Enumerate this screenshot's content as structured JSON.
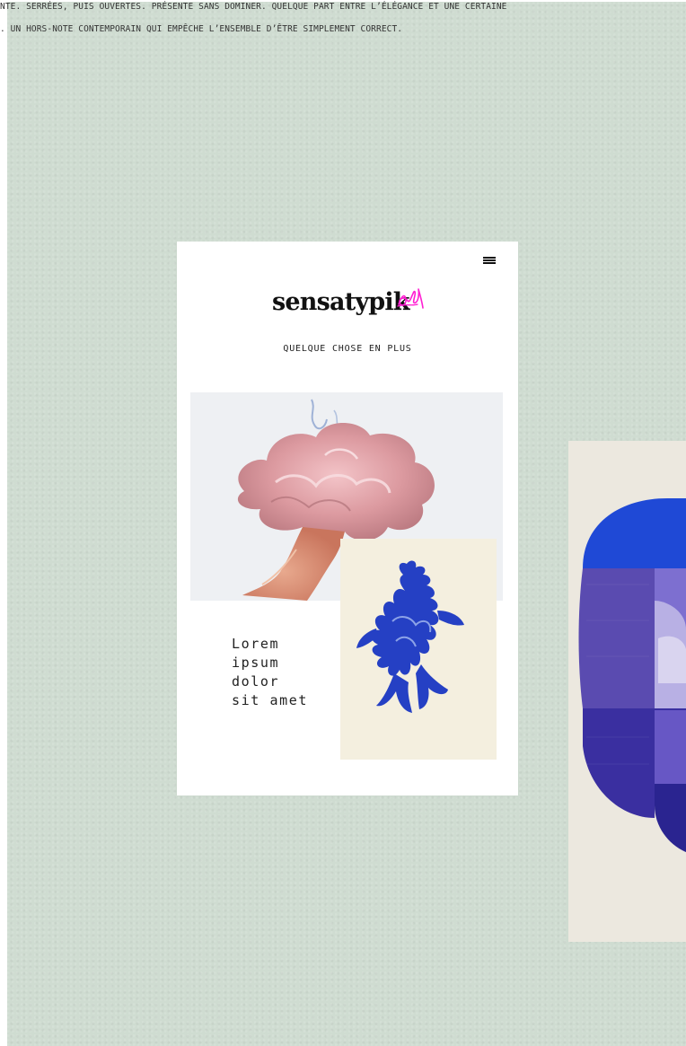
{
  "intro": {
    "line1": "NTE. SERRÉES, PUIS OUVERTES. PRÉSENTE SANS DOMINER. QUELQUE PART ENTRE L’ÉLÉGANCE ET UNE CERTAINE",
    "line2": ". UN HORS-NOTE CONTEMPORAIN QUI EMPÊCHE L’ENSEMBLE D’ÊTRE SIMPLEMENT CORRECT."
  },
  "mockup": {
    "menu_icon": "hamburger-menu-icon",
    "logo_text": "sensatypik",
    "logo_mark_icon": "scribble-signature-icon",
    "logo_mark_color": "#ff1fd2",
    "tagline": "QUELQUE CHOSE EN PLUS",
    "hero_image": "pink-ink-cloud-image",
    "secondary_image": "blue-coral-painting-image",
    "lorem_text": "Lorem\nipsum\ndolor\nsit amet"
  },
  "side_art": {
    "image": "geometric-blue-arch-painting-image"
  },
  "colors": {
    "backdrop": "#cfdcd1",
    "accent": "#ff1fd2",
    "blue": "#1f3fc9"
  }
}
